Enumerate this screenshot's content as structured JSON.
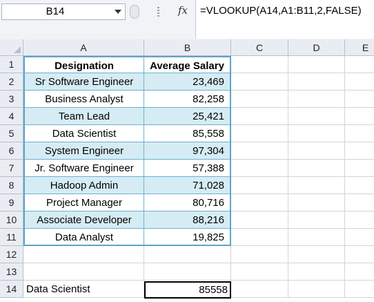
{
  "name_box": {
    "value": "B14"
  },
  "formula_bar": {
    "fx_label": "fx",
    "formula": "=VLOOKUP(A14,A1:B11,2,FALSE)"
  },
  "columns": [
    "A",
    "B",
    "C",
    "D",
    "E"
  ],
  "rows": [
    "1",
    "2",
    "3",
    "4",
    "5",
    "6",
    "7",
    "8",
    "9",
    "10",
    "11",
    "12",
    "13",
    "14"
  ],
  "table": {
    "headers": [
      "Designation",
      "Average Salary"
    ],
    "rows": [
      [
        "Sr Software Engineer",
        "23,469"
      ],
      [
        "Business Analyst",
        "82,258"
      ],
      [
        "Team Lead",
        "25,421"
      ],
      [
        "Data Scientist",
        "85,558"
      ],
      [
        "System Engineer",
        "97,304"
      ],
      [
        "Jr. Software Engineer",
        "57,388"
      ],
      [
        "Hadoop Admin",
        "71,028"
      ],
      [
        "Project Manager",
        "80,716"
      ],
      [
        "Associate Developer",
        "88,216"
      ],
      [
        "Data Analyst",
        "19,825"
      ]
    ]
  },
  "lookup": {
    "label": "Data Scientist",
    "result": "85558"
  },
  "colors": {
    "band": "#d6ecf4",
    "table_border": "#5aa5c8",
    "header_bg": "#e9edf3"
  }
}
